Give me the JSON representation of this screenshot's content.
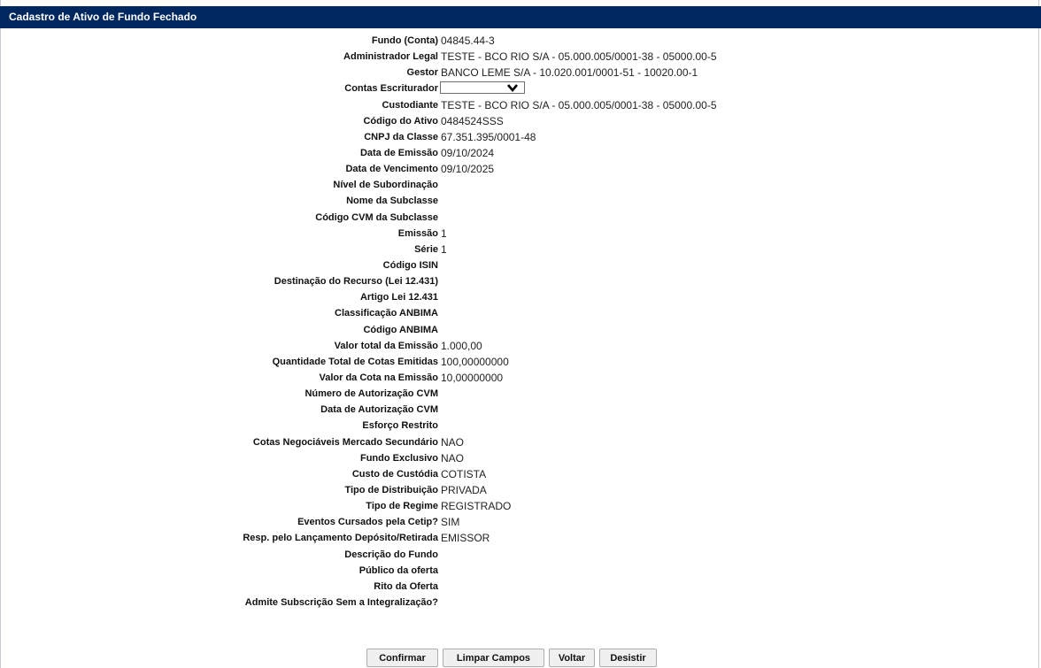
{
  "title": "Cadastro de Ativo de Fundo Fechado",
  "fields": [
    {
      "label": "Fundo (Conta)",
      "value": "04845.44-3"
    },
    {
      "label": "Administrador Legal",
      "value": "TESTE - BCO RIO S/A - 05.000.005/0001-38 - 05000.00-5"
    },
    {
      "label": "Gestor",
      "value": "BANCO LEME S/A - 10.020.001/0001-51 - 10020.00-1"
    },
    {
      "label": "Contas Escriturador",
      "value": "",
      "select": true
    },
    {
      "label": "Custodiante",
      "value": "TESTE - BCO RIO S/A - 05.000.005/0001-38 - 05000.00-5"
    },
    {
      "label": "Código do Ativo",
      "value": "0484524SSS"
    },
    {
      "label": "CNPJ da Classe",
      "value": "67.351.395/0001-48"
    },
    {
      "label": "Data de Emissão",
      "value": "09/10/2024"
    },
    {
      "label": "Data de Vencimento",
      "value": "09/10/2025"
    },
    {
      "label": "Nível de Subordinação",
      "value": ""
    },
    {
      "label": "Nome da Subclasse",
      "value": ""
    },
    {
      "label": "Código CVM da Subclasse",
      "value": ""
    },
    {
      "label": "Emissão",
      "value": "1"
    },
    {
      "label": "Série",
      "value": "1"
    },
    {
      "label": "Código ISIN",
      "value": ""
    },
    {
      "label": "Destinação do Recurso (Lei 12.431)",
      "value": ""
    },
    {
      "label": "Artigo Lei 12.431",
      "value": ""
    },
    {
      "label": "Classificação ANBIMA",
      "value": ""
    },
    {
      "label": "Código ANBIMA",
      "value": ""
    },
    {
      "label": "Valor total da Emissão",
      "value": "1.000,00"
    },
    {
      "label": "Quantidade Total de Cotas Emitidas",
      "value": "100,00000000"
    },
    {
      "label": "Valor da Cota na Emissão",
      "value": "10,00000000"
    },
    {
      "label": "Número de Autorização CVM",
      "value": ""
    },
    {
      "label": "Data de Autorização CVM",
      "value": ""
    },
    {
      "label": "Esforço Restrito",
      "value": ""
    },
    {
      "label": "Cotas Negociáveis Mercado Secundário",
      "value": "NAO"
    },
    {
      "label": "Fundo Exclusivo",
      "value": "NAO"
    },
    {
      "label": "Custo de Custódia",
      "value": "COTISTA"
    },
    {
      "label": "Tipo de Distribuição",
      "value": "PRIVADA"
    },
    {
      "label": "Tipo de Regime",
      "value": "REGISTRADO"
    },
    {
      "label": "Eventos Cursados pela Cetip?",
      "value": "SIM"
    },
    {
      "label": "Resp. pelo Lançamento Depósito/Retirada",
      "value": "EMISSOR"
    },
    {
      "label": "Descrição do Fundo",
      "value": ""
    },
    {
      "label": "Público da oferta",
      "value": ""
    },
    {
      "label": "Rito da Oferta",
      "value": ""
    },
    {
      "label": "Admite Subscrição Sem a Integralização?",
      "value": ""
    }
  ],
  "buttons": {
    "confirmar": "Confirmar",
    "limpar": "Limpar Campos",
    "voltar": "Voltar",
    "desistir": "Desistir"
  },
  "colors": {
    "header_bg": "#00275e",
    "header_text": "#ffffff"
  },
  "icons": {
    "select_arrow": "chevron-down-icon"
  }
}
